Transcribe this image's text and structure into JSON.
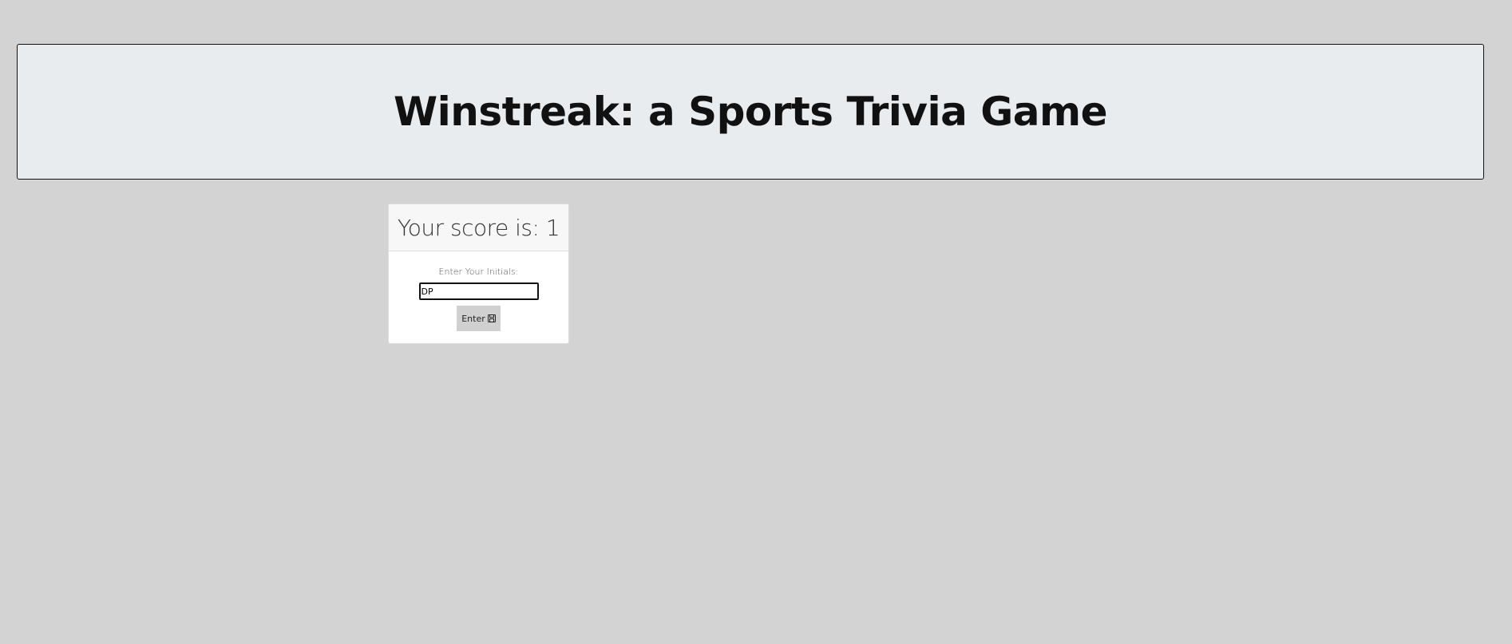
{
  "header": {
    "title": "Winstreak: a Sports Trivia Game"
  },
  "score_card": {
    "score_text": "Your score is: 1",
    "initials_label": "Enter Your Initials:",
    "initials_value": "DP",
    "enter_button_label": "Enter",
    "enter_button_icon": "save-icon"
  }
}
